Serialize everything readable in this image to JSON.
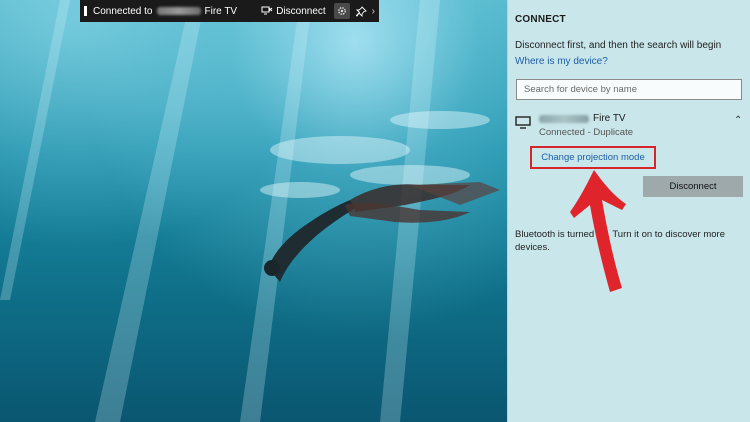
{
  "projection_bar": {
    "status_prefix": "Connected to",
    "device_suffix": "Fire TV",
    "disconnect_label": "Disconnect",
    "chevron": "›"
  },
  "connect_panel": {
    "title": "CONNECT",
    "hint": "Disconnect first, and then the search will begin",
    "where_link": "Where is my device?",
    "search_placeholder": "Search for device by name",
    "device": {
      "name_suffix": "Fire TV",
      "status": "Connected - Duplicate",
      "icon": "monitor-icon"
    },
    "change_mode_link": "Change projection mode",
    "disconnect_button": "Disconnect",
    "bluetooth_message": "Bluetooth is turned off. Turn it on to discover more devices."
  },
  "annotation": {
    "highlight_color": "#d6262c",
    "arrow_color": "#e0242b"
  }
}
